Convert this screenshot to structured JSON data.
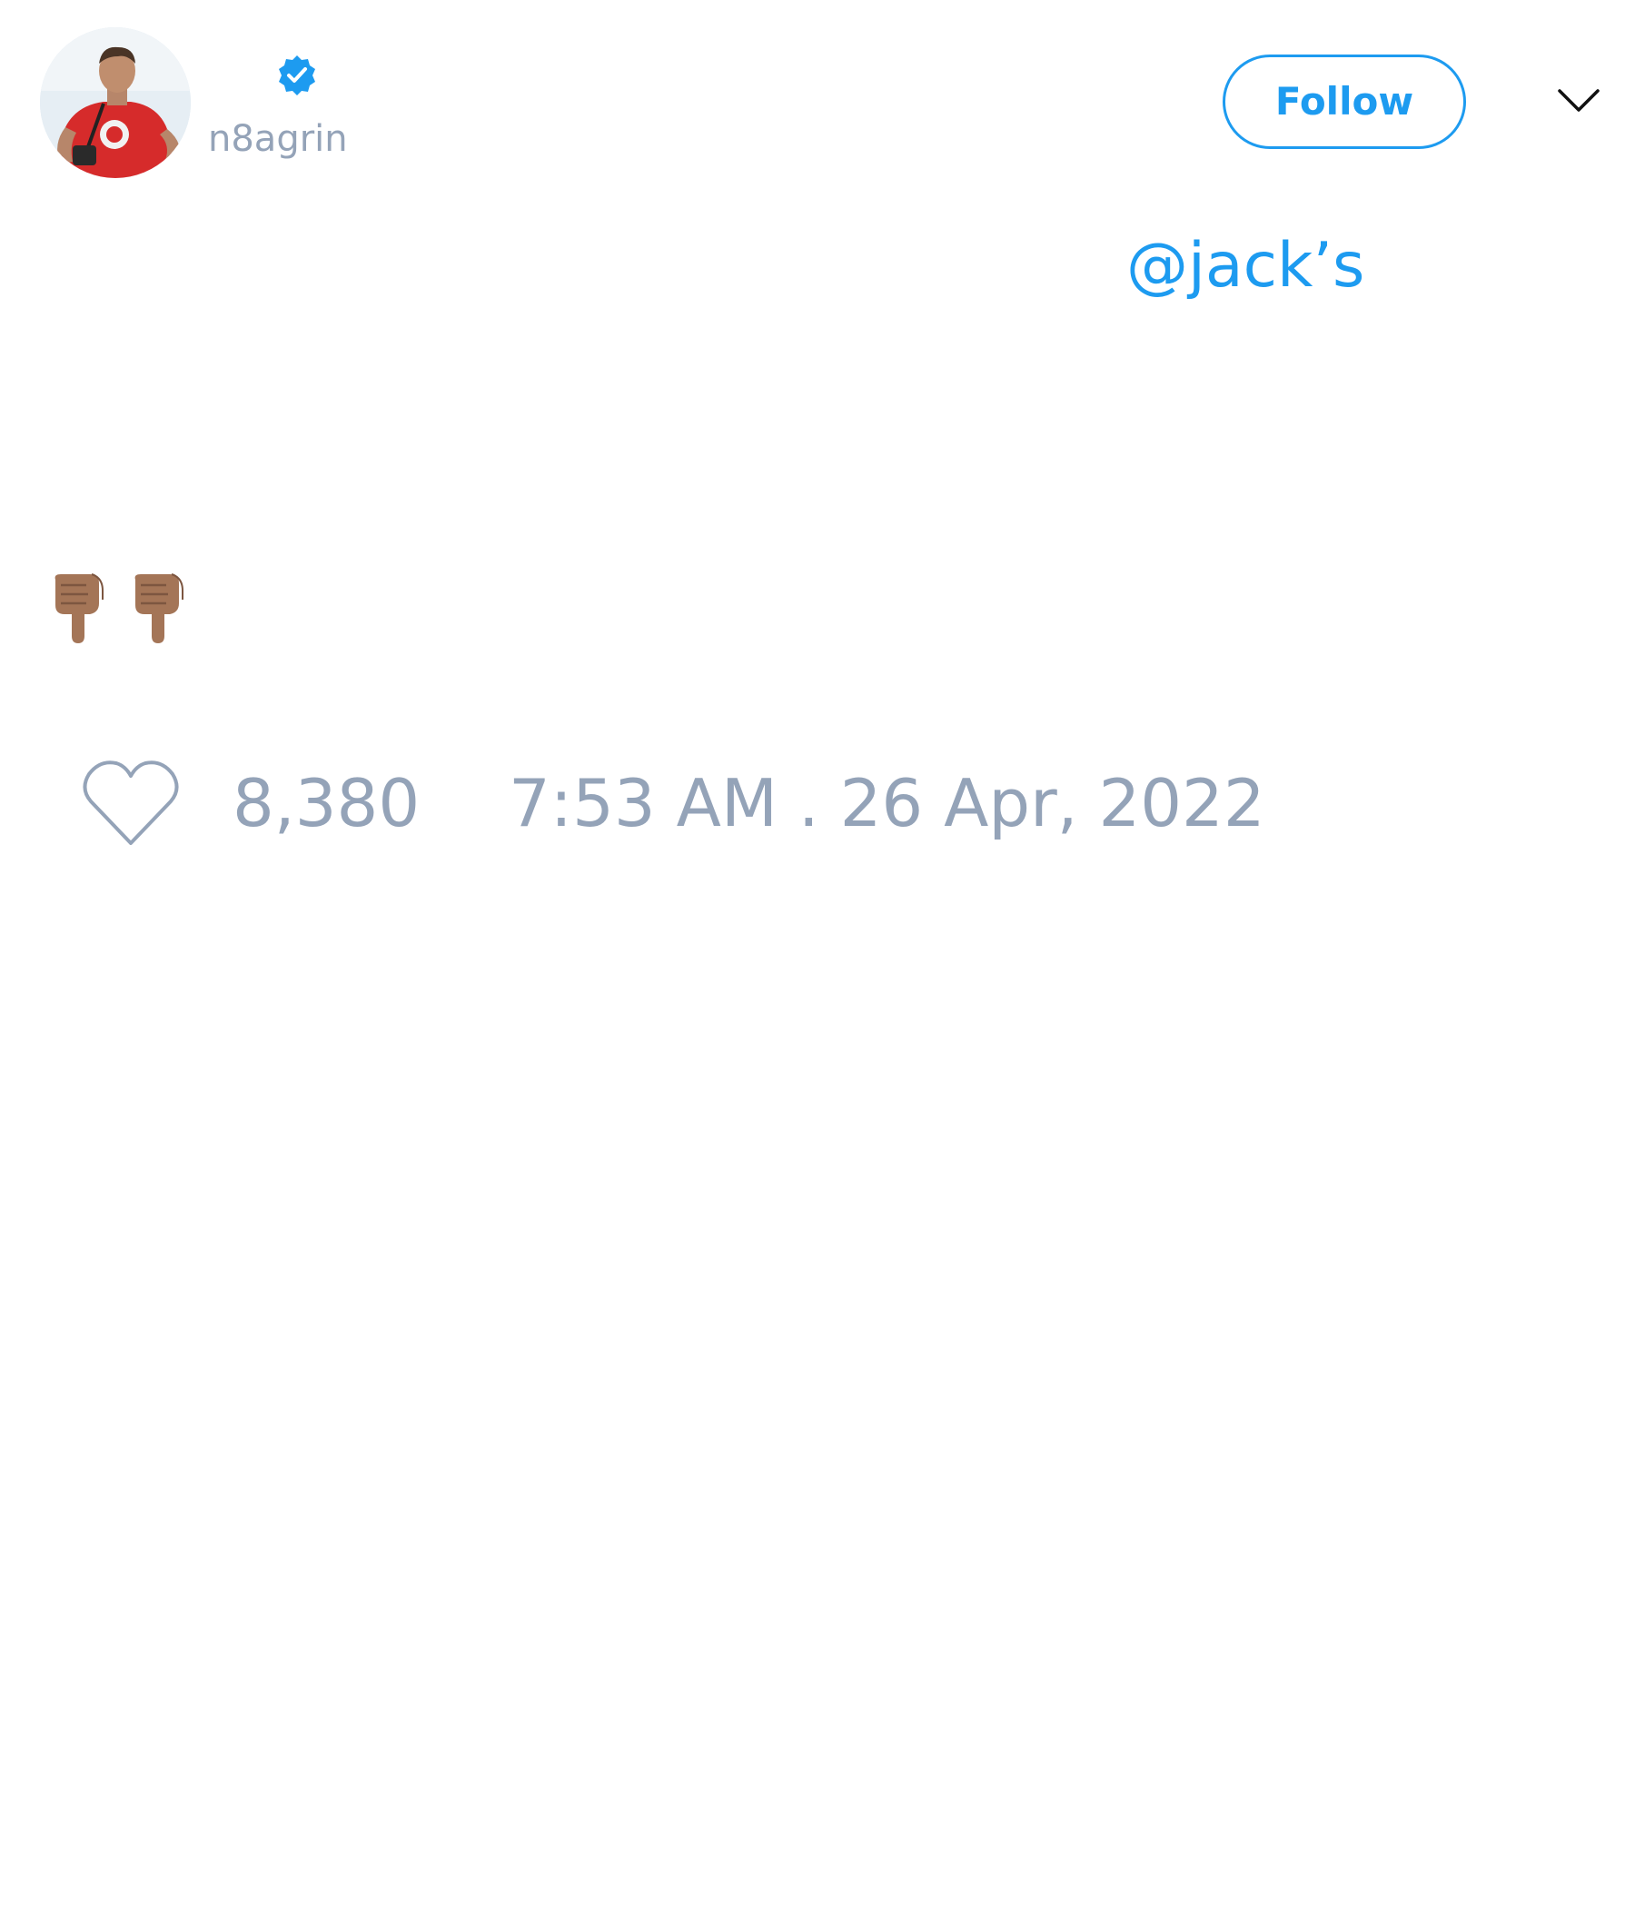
{
  "author": {
    "handle": "n8agrin",
    "avatar_icon": "profile-photo",
    "verified_icon": "verified-badge-icon",
    "verified_color": "#1d9bf0"
  },
  "header": {
    "follow_label": "Follow",
    "menu_icon": "chevron-down-icon"
  },
  "tweet": {
    "mention_text": "@jack’s",
    "emojis": [
      {
        "name": "backhand-index-pointing-down",
        "char": "👇🏽"
      },
      {
        "name": "backhand-index-pointing-down",
        "char": "👇🏽"
      }
    ]
  },
  "footer": {
    "like_icon": "heart-icon",
    "like_count": "8,380",
    "timestamp": "7:53 AM . 26 Apr, 2022"
  },
  "colors": {
    "accent": "#1d9bf0",
    "muted_text": "#94a3b8",
    "background": "#ffffff"
  }
}
